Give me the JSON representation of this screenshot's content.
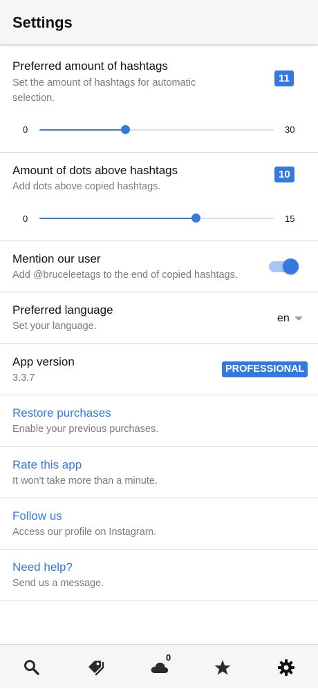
{
  "header": {
    "title": "Settings"
  },
  "hashtags": {
    "title": "Preferred amount of hashtags",
    "subtitle_line1": "Set the amount of hashtags for automatic",
    "subtitle_line2": "selection.",
    "value": "11",
    "min_label": "0",
    "max_label": "30",
    "slider": {
      "min": 0,
      "max": 30,
      "value": 11
    }
  },
  "dots": {
    "title": "Amount of dots above hashtags",
    "subtitle": "Add dots above copied hashtags.",
    "value": "10",
    "min_label": "0",
    "max_label": "15",
    "slider": {
      "min": 0,
      "max": 15,
      "value": 10
    }
  },
  "mention": {
    "title": "Mention our user",
    "subtitle": "Add @bruceleetags to the end of copied hashtags.",
    "enabled": true
  },
  "language": {
    "title": "Preferred language",
    "subtitle": "Set your language.",
    "selected": "en"
  },
  "version": {
    "title": "App version",
    "number": "3.3.7",
    "badge": "PROFESSIONAL"
  },
  "restore": {
    "title": "Restore purchases",
    "subtitle": "Enable your previous purchases."
  },
  "rate": {
    "title": "Rate this app",
    "subtitle": "It won't take more than a minute."
  },
  "follow": {
    "title": "Follow us",
    "subtitle": "Access our profile on Instagram."
  },
  "help": {
    "title": "Need help?",
    "subtitle": "Send us a message."
  },
  "tabbar": {
    "tabs": [
      {
        "icon": "search-icon"
      },
      {
        "icon": "tags-icon"
      },
      {
        "icon": "cloud-icon",
        "count": "0"
      },
      {
        "icon": "star-icon"
      },
      {
        "icon": "gear-icon"
      }
    ]
  },
  "colors": {
    "accent": "#3479e0",
    "track": "#cfe0f8",
    "muted": "#7a7a80"
  }
}
